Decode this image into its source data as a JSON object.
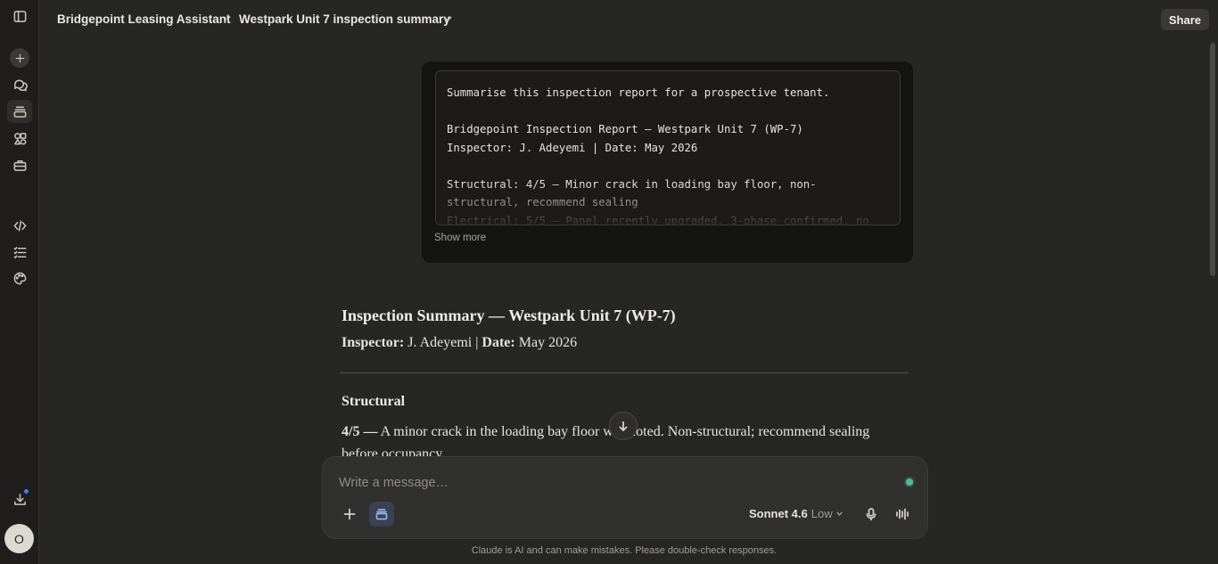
{
  "header": {
    "project": "Bridgepoint Leasing Assistant",
    "separator": "/",
    "chat_title": "Westpark Unit 7 inspection summary",
    "share_label": "Share"
  },
  "sidebar": {
    "avatar_initial": "O",
    "icons": [
      "sidebar-toggle-icon",
      "new-chat-icon",
      "chats-icon",
      "projects-icon",
      "artifacts-icon",
      "tools-icon",
      "code-icon",
      "tasks-icon",
      "palette-icon",
      "download-icon"
    ]
  },
  "user_message": {
    "text": "Summarise this inspection report for a prospective tenant.\n\nBridgepoint Inspection Report — Westpark Unit 7 (WP-7)\nInspector: J. Adeyemi | Date: May 2026\n\nStructural: 4/5 — Minor crack in loading bay floor, non-structural, recommend sealing\nElectrical: 5/5 — Panel recently upgraded, 3-phase confirmed, no",
    "show_more": "Show more"
  },
  "response": {
    "title": "Inspection Summary — Westpark Unit 7 (WP-7)",
    "inspector_label": "Inspector:",
    "inspector_value": " J. Adeyemi | ",
    "date_label": "Date:",
    "date_value": " May 2026",
    "section_structural": "Structural",
    "structural_score": "4/5 —",
    "structural_text": " A minor crack in the loading bay floor was noted. Non-structural; recommend sealing before occupancy."
  },
  "composer": {
    "placeholder": "Write a message…",
    "model": "Sonnet 4.6",
    "effort": "Low"
  },
  "disclaimer": "Claude is AI and can make mistakes. Please double-check responses."
}
